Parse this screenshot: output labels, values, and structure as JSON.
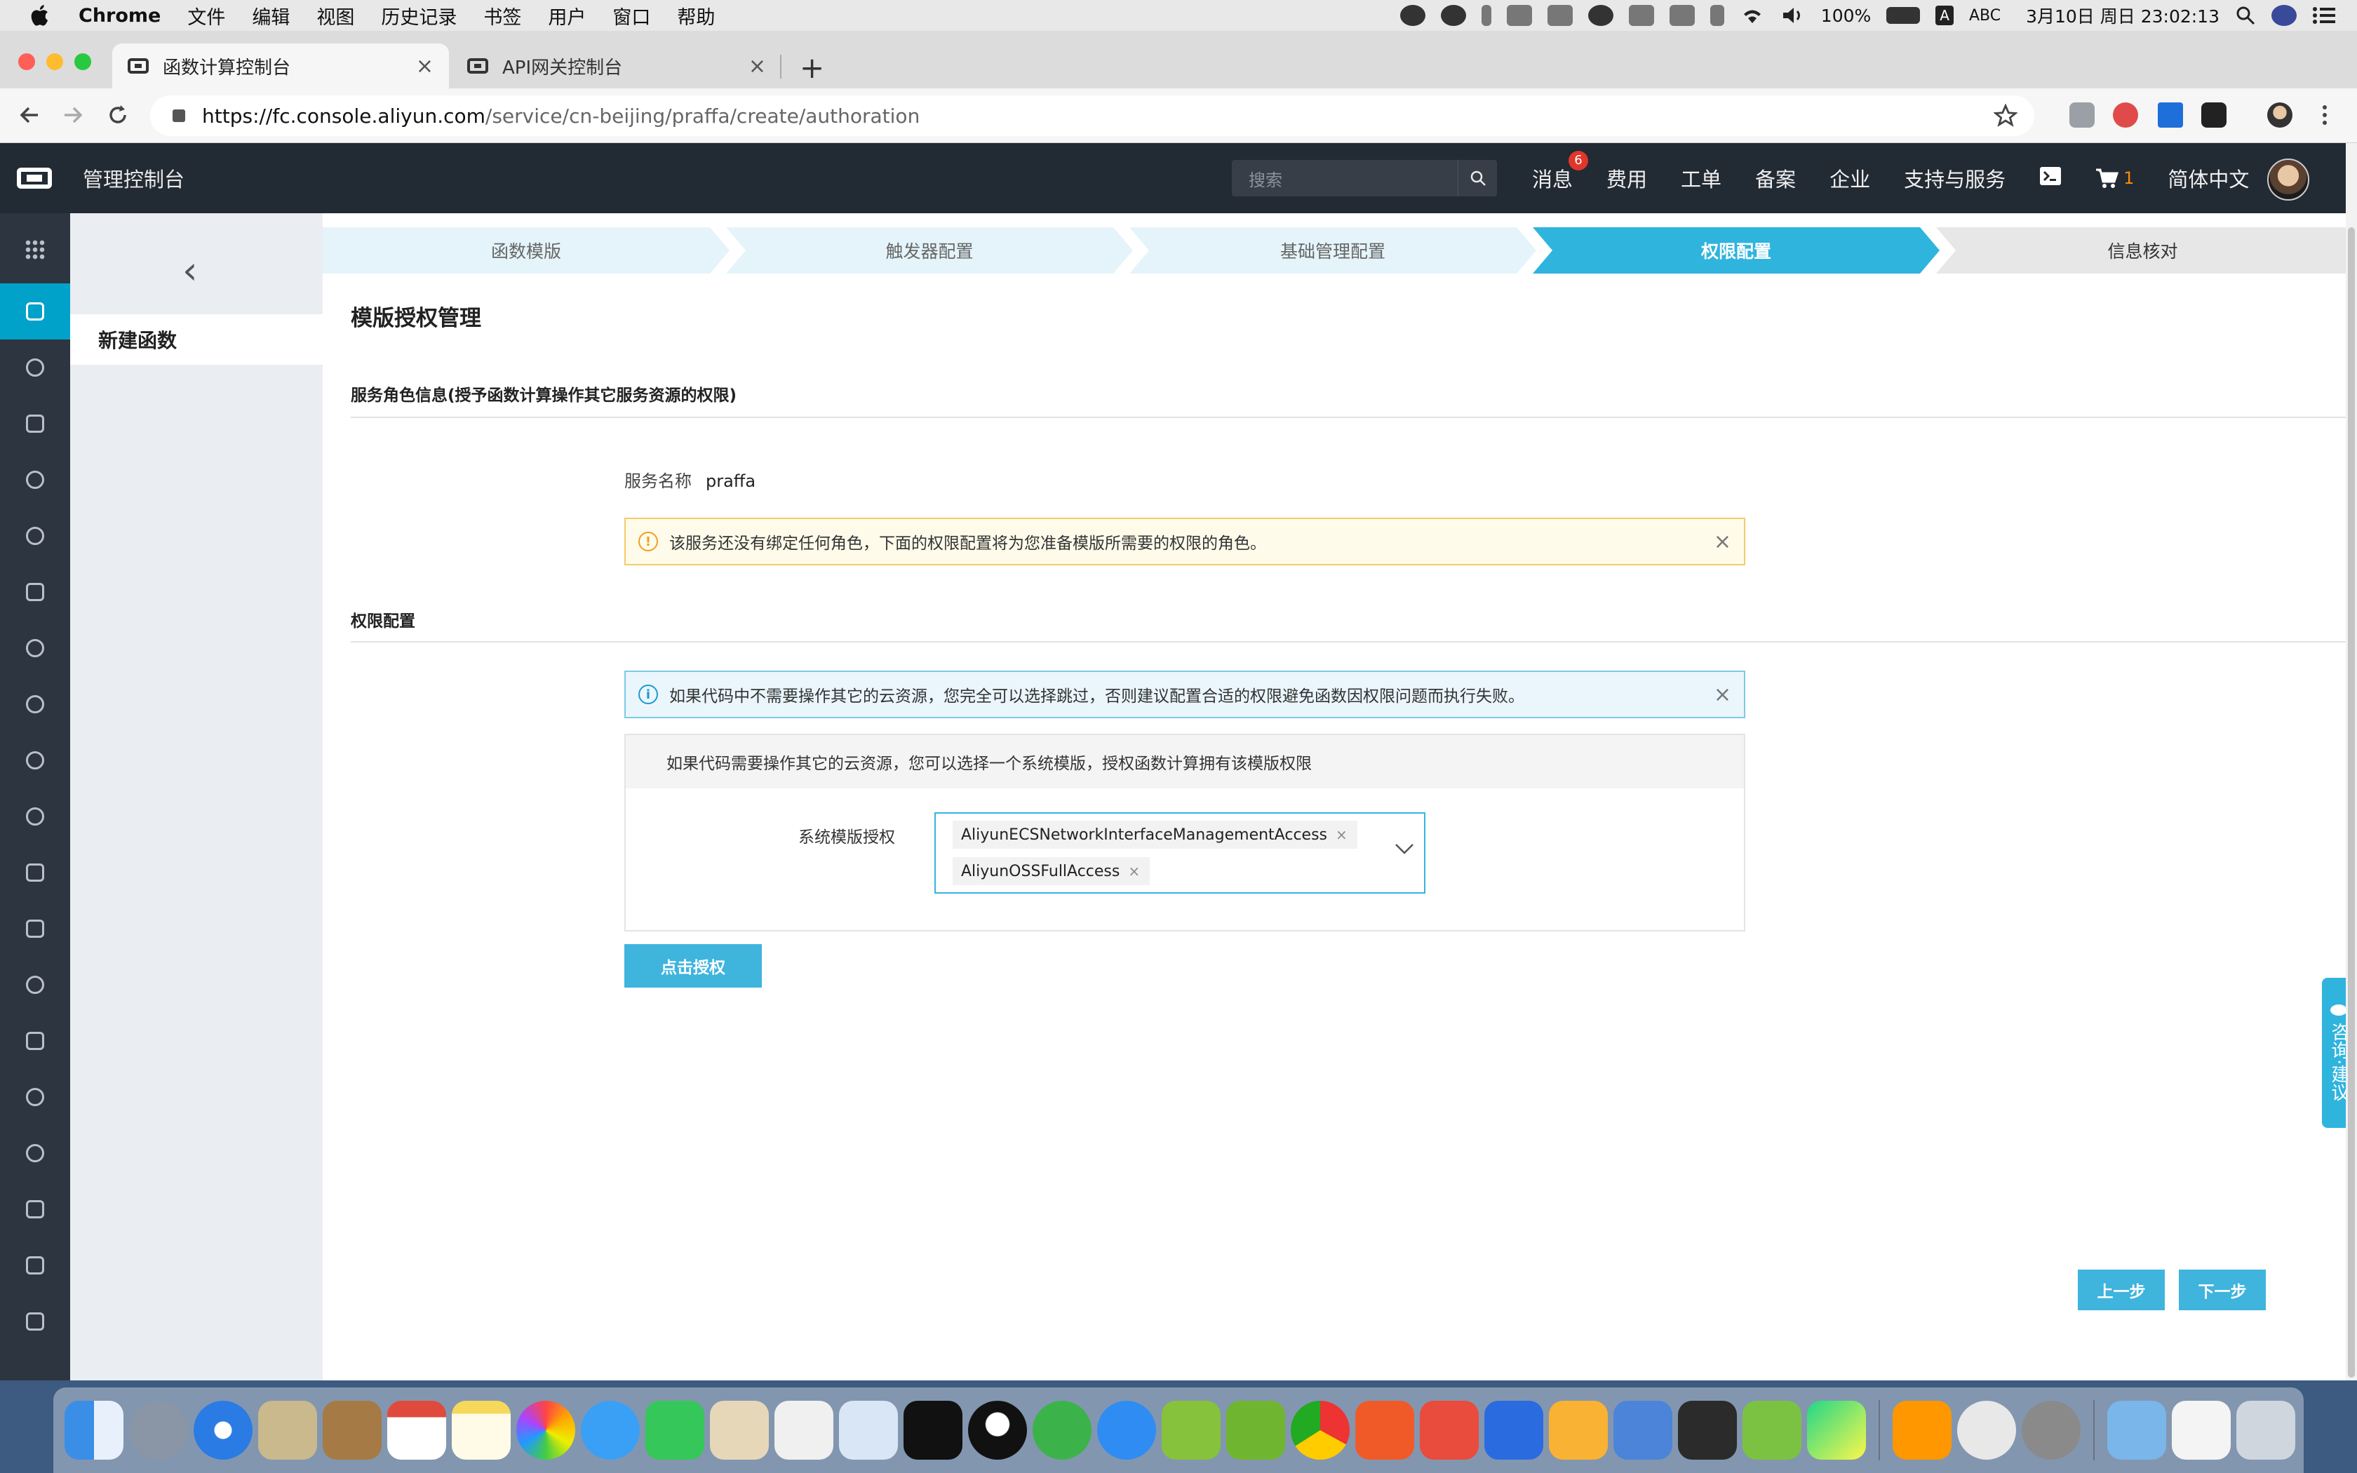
{
  "menubar": {
    "items": [
      "Chrome",
      "文件",
      "编辑",
      "视图",
      "历史记录",
      "书签",
      "用户",
      "窗口",
      "帮助"
    ],
    "battery": "100%",
    "input_method": "ABC",
    "input_badge": "A",
    "datetime": "3月10日 周日 23:02:13"
  },
  "browser": {
    "tabs": [
      {
        "title": "函数计算控制台",
        "active": true
      },
      {
        "title": "API网关控制台",
        "active": false
      }
    ],
    "close_glyph": "×",
    "new_tab_glyph": "+",
    "url_host": "https://fc.console.aliyun.com",
    "url_path": "/service/cn-beijing/praffa/create/authoration"
  },
  "header": {
    "title": "管理控制台",
    "search_placeholder": "搜索",
    "nav": [
      "消息",
      "费用",
      "工单",
      "备案",
      "企业",
      "支持与服务"
    ],
    "message_badge": "6",
    "cart_count": "1",
    "language": "简体中文"
  },
  "sidebar": {
    "back_glyph": "‹",
    "active_item": "新建函数"
  },
  "steps": [
    {
      "label": "函数模版",
      "state": "done"
    },
    {
      "label": "触发器配置",
      "state": "done"
    },
    {
      "label": "基础管理配置",
      "state": "done"
    },
    {
      "label": "权限配置",
      "state": "current"
    },
    {
      "label": "信息核对",
      "state": "todo"
    }
  ],
  "content": {
    "page_title": "模版授权管理",
    "role_section_title": "服务角色信息(授予函数计算操作其它服务资源的权限)",
    "service_name_label": "服务名称",
    "service_name_value": "praffa",
    "warning_text": "该服务还没有绑定任何角色，下面的权限配置将为您准备模版所需要的权限的角色。",
    "perm_section_title": "权限配置",
    "info_text": "如果代码中不需要操作其它的云资源，您完全可以选择跳过，否则建议配置合适的权限避免函数因权限问题而执行失败。",
    "perm_box_hint": "如果代码需要操作其它的云资源，您可以选择一个系统模版，授权函数计算拥有该模版权限",
    "template_label": "系统模版授权",
    "selected_templates": [
      "AliyunECSNetworkInterfaceManagementAccess",
      "AliyunOSSFullAccess"
    ],
    "authorize_button": "点击授权",
    "prev_button": "上一步",
    "next_button": "下一步",
    "feedback_tab": "咨询·建议"
  },
  "colors": {
    "accent": "#2fb4de",
    "header_bg": "#222a33",
    "rail_bg": "#2d3540",
    "warning_border": "#f3cc68",
    "info_border": "#7ccbe6",
    "badge": "#e0362c"
  },
  "icons": {
    "rail": [
      "grid-icon",
      "function-icon",
      "network-icon",
      "console-logo-icon",
      "search-icon",
      "cloud-icon",
      "shield-icon",
      "microphone-icon",
      "record-icon",
      "dns-icon",
      "link-cloud-icon",
      "wave-icon",
      "chat-icon",
      "cloud-sync-icon",
      "list-icon",
      "brain-icon",
      "cluster-icon",
      "cross-arrows-icon",
      "swap-icon",
      "layers-icon"
    ]
  }
}
